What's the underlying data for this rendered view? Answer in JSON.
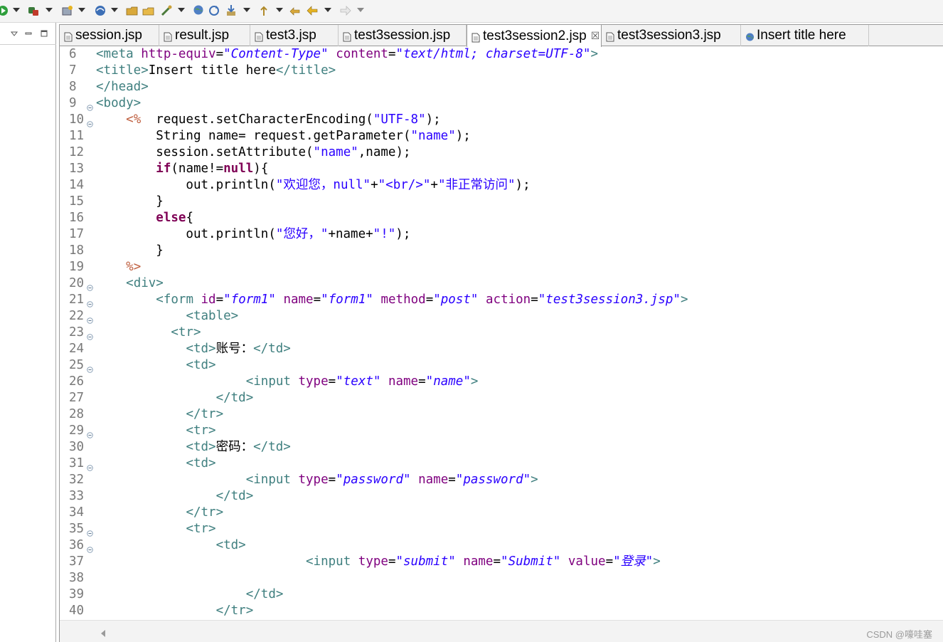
{
  "toolbar": {
    "icons": [
      "run-icon",
      "debug-icon",
      "new-server-icon",
      "web-browser-icon",
      "open-folder-icon",
      "open-file-icon",
      "deploy-icon",
      "globe-icon",
      "sync-icon",
      "download-icon",
      "upload-icon",
      "back-icon",
      "forward-icon"
    ]
  },
  "tabs": [
    {
      "label": "session.jsp",
      "icon": "jsp-file-icon",
      "active": false
    },
    {
      "label": "result.jsp",
      "icon": "jsp-file-icon",
      "active": false
    },
    {
      "label": "test3.jsp",
      "icon": "jsp-file-icon",
      "active": false
    },
    {
      "label": "test3session.jsp",
      "icon": "jsp-file-icon",
      "active": false
    },
    {
      "label": "test3session2.jsp",
      "icon": "jsp-file-icon",
      "active": true,
      "close": "☒"
    },
    {
      "label": "test3session3.jsp",
      "icon": "jsp-file-icon",
      "active": false
    },
    {
      "label": "Insert title here",
      "icon": "globe-icon",
      "active": false
    }
  ],
  "editor": {
    "lines": [
      {
        "n": "6",
        "fold": false,
        "tokens": [
          [
            "tag",
            "<meta "
          ],
          [
            "attr",
            "http-equiv"
          ],
          [
            "pl",
            "="
          ],
          [
            "val",
            "\"Content-Type\""
          ],
          [
            "pl",
            " "
          ],
          [
            "attr",
            "content"
          ],
          [
            "pl",
            "="
          ],
          [
            "val",
            "\"text/html; charset=UTF-8\""
          ],
          [
            "tag",
            ">"
          ]
        ]
      },
      {
        "n": "7",
        "fold": false,
        "tokens": [
          [
            "tag",
            "<title>"
          ],
          [
            "pl",
            "Insert title here"
          ],
          [
            "tag",
            "</title>"
          ]
        ]
      },
      {
        "n": "8",
        "fold": false,
        "tokens": [
          [
            "tag",
            "</head>"
          ]
        ]
      },
      {
        "n": "9",
        "fold": true,
        "tokens": [
          [
            "tag",
            "<body>"
          ]
        ]
      },
      {
        "n": "10",
        "fold": true,
        "tokens": [
          [
            "pl",
            "    "
          ],
          [
            "jsp",
            "<%"
          ],
          [
            "pl",
            "  request.setCharacterEncoding("
          ],
          [
            "str",
            "\"UTF-8\""
          ],
          [
            "pl",
            ");"
          ]
        ]
      },
      {
        "n": "11",
        "fold": false,
        "tokens": [
          [
            "pl",
            "        String name= request.getParameter("
          ],
          [
            "str",
            "\"name\""
          ],
          [
            "pl",
            ");"
          ]
        ]
      },
      {
        "n": "12",
        "fold": false,
        "tokens": [
          [
            "pl",
            "        session.setAttribute("
          ],
          [
            "str",
            "\"name\""
          ],
          [
            "pl",
            ",name);"
          ]
        ]
      },
      {
        "n": "13",
        "fold": false,
        "tokens": [
          [
            "pl",
            "        "
          ],
          [
            "kw",
            "if"
          ],
          [
            "pl",
            "(name!="
          ],
          [
            "kw",
            "null"
          ],
          [
            "pl",
            "){"
          ]
        ]
      },
      {
        "n": "14",
        "fold": false,
        "tokens": [
          [
            "pl",
            "            out.println("
          ],
          [
            "str",
            "\"欢迎您，null\""
          ],
          [
            "pl",
            "+"
          ],
          [
            "str",
            "\"<br/>\""
          ],
          [
            "pl",
            "+"
          ],
          [
            "str",
            "\"非正常访问\""
          ],
          [
            "pl",
            ");"
          ]
        ]
      },
      {
        "n": "15",
        "fold": false,
        "tokens": [
          [
            "pl",
            "        }"
          ]
        ]
      },
      {
        "n": "16",
        "fold": false,
        "tokens": [
          [
            "pl",
            "        "
          ],
          [
            "kw",
            "else"
          ],
          [
            "pl",
            "{"
          ]
        ]
      },
      {
        "n": "17",
        "fold": false,
        "tokens": [
          [
            "pl",
            "            out.println("
          ],
          [
            "str",
            "\"您好，\""
          ],
          [
            "pl",
            "+name+"
          ],
          [
            "str",
            "\"!\""
          ],
          [
            "pl",
            ");"
          ]
        ]
      },
      {
        "n": "18",
        "fold": false,
        "tokens": [
          [
            "pl",
            "        }"
          ]
        ]
      },
      {
        "n": "19",
        "fold": false,
        "tokens": [
          [
            "pl",
            "    "
          ],
          [
            "jsp",
            "%>"
          ]
        ]
      },
      {
        "n": "20",
        "fold": true,
        "tokens": [
          [
            "pl",
            "    "
          ],
          [
            "tag",
            "<div>"
          ]
        ]
      },
      {
        "n": "21",
        "fold": true,
        "tokens": [
          [
            "pl",
            "        "
          ],
          [
            "tag",
            "<form "
          ],
          [
            "attr",
            "id"
          ],
          [
            "pl",
            "="
          ],
          [
            "val",
            "\"form1\""
          ],
          [
            "pl",
            " "
          ],
          [
            "attr",
            "name"
          ],
          [
            "pl",
            "="
          ],
          [
            "val",
            "\"form1\""
          ],
          [
            "pl",
            " "
          ],
          [
            "attr",
            "method"
          ],
          [
            "pl",
            "="
          ],
          [
            "val",
            "\"post\""
          ],
          [
            "pl",
            " "
          ],
          [
            "attr",
            "action"
          ],
          [
            "pl",
            "="
          ],
          [
            "val",
            "\"test3session3.jsp\""
          ],
          [
            "tag",
            ">"
          ]
        ]
      },
      {
        "n": "22",
        "fold": true,
        "tokens": [
          [
            "pl",
            "            "
          ],
          [
            "tag",
            "<table>"
          ]
        ]
      },
      {
        "n": "23",
        "fold": true,
        "tokens": [
          [
            "pl",
            "          "
          ],
          [
            "tag",
            "<tr>"
          ]
        ]
      },
      {
        "n": "24",
        "fold": false,
        "tokens": [
          [
            "pl",
            "            "
          ],
          [
            "tag",
            "<td>"
          ],
          [
            "pl",
            "账号："
          ],
          [
            "tag",
            "</td>"
          ]
        ]
      },
      {
        "n": "25",
        "fold": true,
        "tokens": [
          [
            "pl",
            "            "
          ],
          [
            "tag",
            "<td>"
          ]
        ]
      },
      {
        "n": "26",
        "fold": false,
        "tokens": [
          [
            "pl",
            "                    "
          ],
          [
            "tag",
            "<input "
          ],
          [
            "attr",
            "type"
          ],
          [
            "pl",
            "="
          ],
          [
            "val",
            "\"text\""
          ],
          [
            "pl",
            " "
          ],
          [
            "attr",
            "name"
          ],
          [
            "pl",
            "="
          ],
          [
            "val",
            "\"name\""
          ],
          [
            "tag",
            ">"
          ]
        ]
      },
      {
        "n": "27",
        "fold": false,
        "tokens": [
          [
            "pl",
            "                "
          ],
          [
            "tag",
            "</td>"
          ]
        ]
      },
      {
        "n": "28",
        "fold": false,
        "tokens": [
          [
            "pl",
            "            "
          ],
          [
            "tag",
            "</tr>"
          ]
        ]
      },
      {
        "n": "29",
        "fold": true,
        "tokens": [
          [
            "pl",
            "            "
          ],
          [
            "tag",
            "<tr>"
          ]
        ]
      },
      {
        "n": "30",
        "fold": false,
        "tokens": [
          [
            "pl",
            "            "
          ],
          [
            "tag",
            "<td>"
          ],
          [
            "pl",
            "密码："
          ],
          [
            "tag",
            "</td>"
          ]
        ]
      },
      {
        "n": "31",
        "fold": true,
        "tokens": [
          [
            "pl",
            "            "
          ],
          [
            "tag",
            "<td>"
          ]
        ]
      },
      {
        "n": "32",
        "fold": false,
        "tokens": [
          [
            "pl",
            "                    "
          ],
          [
            "tag",
            "<input "
          ],
          [
            "attr",
            "type"
          ],
          [
            "pl",
            "="
          ],
          [
            "val",
            "\"password\""
          ],
          [
            "pl",
            " "
          ],
          [
            "attr",
            "name"
          ],
          [
            "pl",
            "="
          ],
          [
            "val",
            "\"password\""
          ],
          [
            "tag",
            ">"
          ]
        ]
      },
      {
        "n": "33",
        "fold": false,
        "tokens": [
          [
            "pl",
            "                "
          ],
          [
            "tag",
            "</td>"
          ]
        ]
      },
      {
        "n": "34",
        "fold": false,
        "tokens": [
          [
            "pl",
            "            "
          ],
          [
            "tag",
            "</tr>"
          ]
        ]
      },
      {
        "n": "35",
        "fold": true,
        "tokens": [
          [
            "pl",
            "            "
          ],
          [
            "tag",
            "<tr>"
          ]
        ]
      },
      {
        "n": "36",
        "fold": true,
        "tokens": [
          [
            "pl",
            "                "
          ],
          [
            "tag",
            "<td>"
          ]
        ]
      },
      {
        "n": "37",
        "fold": false,
        "tokens": [
          [
            "pl",
            "                            "
          ],
          [
            "tag",
            "<input "
          ],
          [
            "attr",
            "type"
          ],
          [
            "pl",
            "="
          ],
          [
            "val",
            "\"submit\""
          ],
          [
            "pl",
            " "
          ],
          [
            "attr",
            "name"
          ],
          [
            "pl",
            "="
          ],
          [
            "val",
            "\"Submit\""
          ],
          [
            "pl",
            " "
          ],
          [
            "attr",
            "value"
          ],
          [
            "pl",
            "="
          ],
          [
            "val",
            "\"登录\""
          ],
          [
            "tag",
            ">"
          ]
        ]
      },
      {
        "n": "38",
        "fold": false,
        "tokens": []
      },
      {
        "n": "39",
        "fold": false,
        "tokens": [
          [
            "pl",
            "                    "
          ],
          [
            "tag",
            "</td>"
          ]
        ]
      },
      {
        "n": "40",
        "fold": false,
        "tokens": [
          [
            "pl",
            "                "
          ],
          [
            "tag",
            "</tr>"
          ]
        ]
      }
    ]
  },
  "footer": {
    "watermark": "CSDN @嚎哇塞"
  },
  "colors": {
    "tag": "#3f7f7f",
    "attr": "#7f007f",
    "value": "#2a00ff",
    "keyword": "#7f0055",
    "jsp": "#bf5f3f",
    "line_number": "#787878"
  }
}
